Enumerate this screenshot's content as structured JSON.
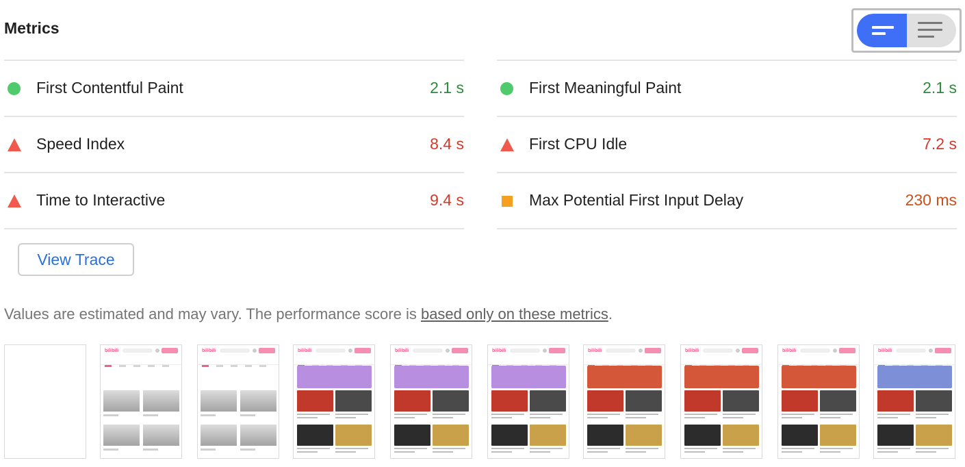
{
  "section": {
    "title": "Metrics",
    "view_toggle": {
      "selected": "compact",
      "options": [
        "compact",
        "expanded"
      ]
    }
  },
  "metrics": [
    {
      "label": "First Contentful Paint",
      "value": "2.1 s",
      "rating": "pass"
    },
    {
      "label": "First Meaningful Paint",
      "value": "2.1 s",
      "rating": "pass"
    },
    {
      "label": "Speed Index",
      "value": "8.4 s",
      "rating": "fail"
    },
    {
      "label": "First CPU Idle",
      "value": "7.2 s",
      "rating": "fail"
    },
    {
      "label": "Time to Interactive",
      "value": "9.4 s",
      "rating": "fail"
    },
    {
      "label": "Max Potential First Input Delay",
      "value": "230 ms",
      "rating": "average"
    }
  ],
  "actions": {
    "view_trace": "View Trace"
  },
  "note": {
    "prefix": "Values are estimated and may vary. The performance score is ",
    "link": "based only on these metrics",
    "suffix": "."
  },
  "colors": {
    "pass": "#4fcb6b",
    "fail": "#f0594b",
    "average": "#f5a021",
    "toggle_active": "#3e6ff6",
    "link": "#2b6fd9"
  },
  "filmstrip": {
    "frames": [
      "blank",
      "placeholders",
      "placeholders",
      "content-a",
      "content-a",
      "content-a",
      "content-b",
      "content-b",
      "content-b",
      "content-c"
    ],
    "brand_text": "bilibili"
  }
}
